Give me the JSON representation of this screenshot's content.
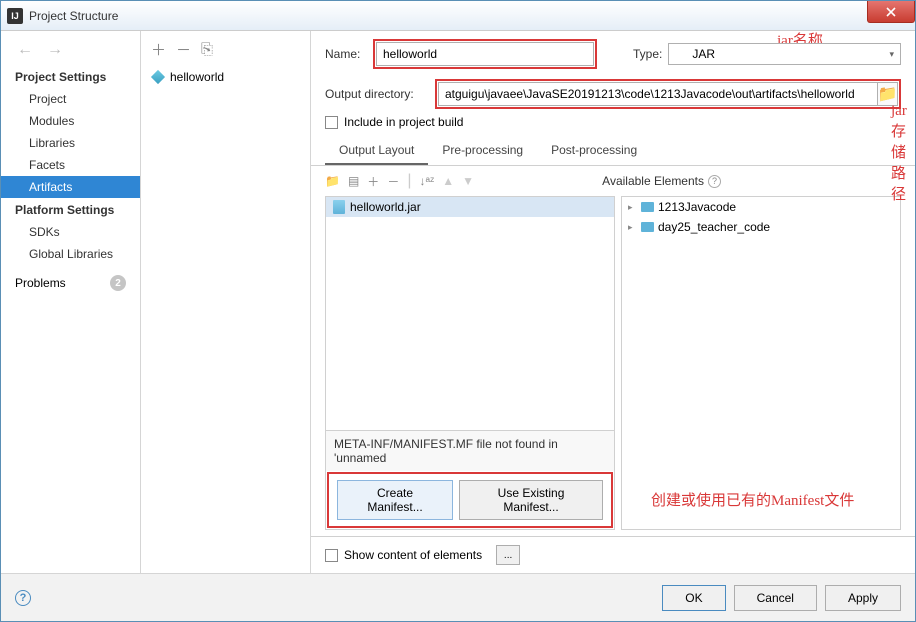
{
  "window": {
    "title": "Project Structure"
  },
  "sidebar1": {
    "section_project": "Project Settings",
    "items_project": [
      "Project",
      "Modules",
      "Libraries",
      "Facets",
      "Artifacts"
    ],
    "section_platform": "Platform Settings",
    "items_platform": [
      "SDKs",
      "Global Libraries"
    ],
    "problems": "Problems",
    "problems_count": "2"
  },
  "sidebar2": {
    "item": "helloworld"
  },
  "form": {
    "name_label": "Name:",
    "name_value": "helloworld",
    "type_label": "Type:",
    "type_value": "JAR",
    "output_label": "Output directory:",
    "output_value": "atguigu\\javaee\\JavaSE20191213\\code\\1213Javacode\\out\\artifacts\\helloworld",
    "include_label": "Include in project build"
  },
  "tabs": [
    "Output Layout",
    "Pre-processing",
    "Post-processing"
  ],
  "layout": {
    "available_label": "Available Elements",
    "left_item": "helloworld.jar",
    "right_items": [
      "1213Javacode",
      "day25_teacher_code"
    ],
    "notfound": "META-INF/MANIFEST.MF file not found in 'unnamed",
    "create_manifest": "Create Manifest...",
    "use_existing": "Use Existing Manifest..."
  },
  "show_content": "Show content of elements",
  "annotations": {
    "jar_name": "jar名称",
    "storage_path": "jar存储路径",
    "manifest_note": "创建或使用已有的Manifest文件"
  },
  "buttons": {
    "ok": "OK",
    "cancel": "Cancel",
    "apply": "Apply"
  }
}
